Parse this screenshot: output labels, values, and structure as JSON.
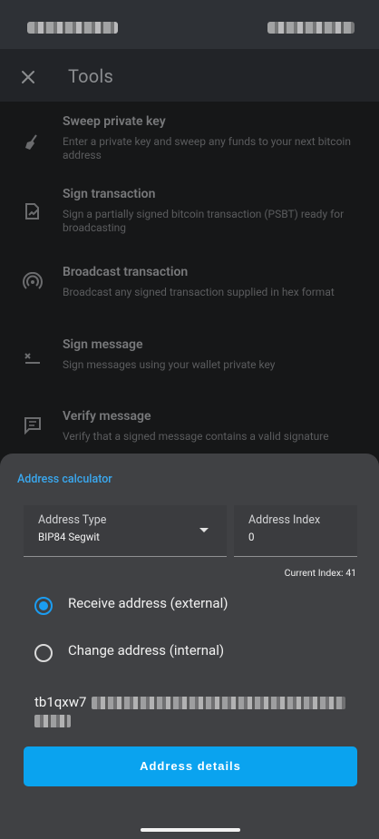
{
  "app": {
    "title": "Tools"
  },
  "tools": [
    {
      "title": "Sweep private key",
      "desc": "Enter a private key and sweep any funds to your next bitcoin address"
    },
    {
      "title": "Sign transaction",
      "desc": "Sign a partially signed bitcoin transaction (PSBT) ready for broadcasting"
    },
    {
      "title": "Broadcast transaction",
      "desc": "Broadcast any signed transaction supplied in hex format"
    },
    {
      "title": "Sign message",
      "desc": "Sign messages using your wallet private key"
    },
    {
      "title": "Verify message",
      "desc": "Verify that a signed message contains a valid signature"
    }
  ],
  "sheet": {
    "title": "Address calculator",
    "address_type": {
      "label": "Address Type",
      "value": "BIP84 Segwit"
    },
    "address_index": {
      "label": "Address Index",
      "value": "0"
    },
    "current_index": "Current Index: 41",
    "radios": [
      {
        "label": "Receive address (external)",
        "checked": true
      },
      {
        "label": "Change address (internal)",
        "checked": false
      }
    ],
    "address_prefix": "tb1qxw7",
    "button_label": "Address details"
  },
  "colors": {
    "accent": "#0aa3ef",
    "sheet_bg": "#404144",
    "title_accent": "#3aa8ef"
  }
}
